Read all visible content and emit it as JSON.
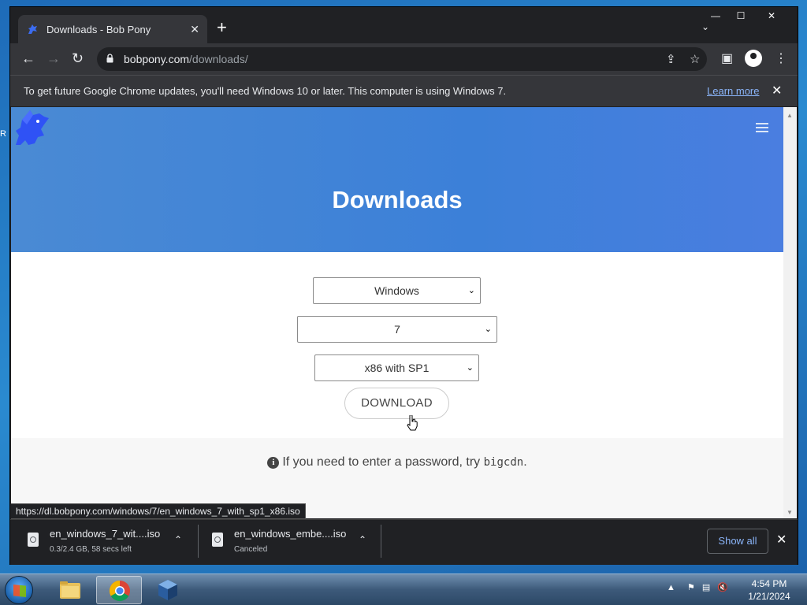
{
  "desktop": {
    "edge_label": "R"
  },
  "window_controls": {
    "minimize": "—",
    "maximize": "☐",
    "close": "✕"
  },
  "tab": {
    "title": "Downloads - Bob Pony",
    "close": "✕",
    "favicon": "bobpony-icon"
  },
  "new_tab": "+",
  "tab_list": "⌄",
  "toolbar": {
    "back": "←",
    "forward": "→",
    "reload": "↻",
    "url_host": "bobpony.com",
    "url_path": "/downloads/",
    "share": "⇪",
    "bookmark": "☆",
    "side_panel": "▣",
    "menu": "⋮"
  },
  "infobar": {
    "message": "To get future Google Chrome updates, you'll need Windows 10 or later. This computer is using Windows 7.",
    "link": "Learn more",
    "close": "✕"
  },
  "page": {
    "title": "Downloads",
    "os_select": "Windows",
    "version_select": "7",
    "edition_select": "x86 with SP1",
    "download_button": "DOWNLOAD",
    "password_note_prefix": "If you need to enter a password, try",
    "password_code": "bigcdn",
    "password_note_suffix": ".",
    "select_chevron": "⌄"
  },
  "status_url": "https://dl.bobpony.com/windows/7/en_windows_7_with_sp1_x86.iso",
  "downloads": [
    {
      "name": "en_windows_7_wit....iso",
      "status": "0.3/2.4 GB, 58 secs left"
    },
    {
      "name": "en_windows_embe....iso",
      "status": "Canceled"
    }
  ],
  "shelf": {
    "show_all": "Show all",
    "close": "✕",
    "chevron": "⌃"
  },
  "taskbar": {
    "apps": [
      "explorer-icon",
      "chrome-icon",
      "virtualbox-icon"
    ],
    "time": "4:54 PM",
    "date": "1/21/2024",
    "tray_arrow": "▲"
  },
  "colors": {
    "hero": "#3c80d8",
    "chrome_dark": "#202124",
    "link": "#8ab4f8"
  }
}
